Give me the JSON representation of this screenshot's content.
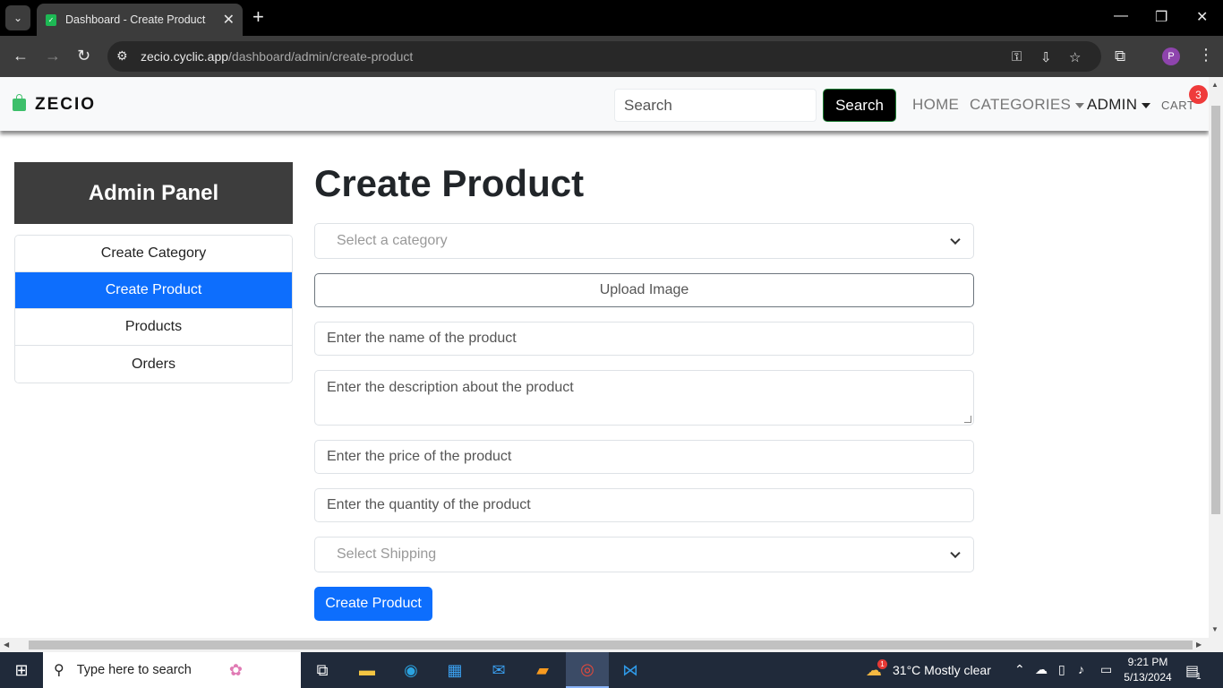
{
  "browser": {
    "tab_title": "Dashboard - Create Product",
    "url_domain": "zecio.cyclic.app",
    "url_path": "/dashboard/admin/create-product",
    "profile_initial": "P"
  },
  "navbar": {
    "brand": "ZECIO",
    "search_placeholder": "Search",
    "search_button": "Search",
    "links": {
      "home": "HOME",
      "categories": "CATEGORIES",
      "admin": "ADMIN",
      "cart": "CART"
    },
    "cart_count": "3"
  },
  "sidebar": {
    "title": "Admin Panel",
    "items": [
      {
        "label": "Create Category",
        "active": false
      },
      {
        "label": "Create Product",
        "active": true
      },
      {
        "label": "Products",
        "active": false
      },
      {
        "label": "Orders",
        "active": false
      }
    ]
  },
  "form": {
    "heading": "Create Product",
    "category_placeholder": "Select a category",
    "upload_label": "Upload Image",
    "name_placeholder": "Enter the name of the product",
    "description_placeholder": "Enter the description about the product",
    "price_placeholder": "Enter the price of the product",
    "quantity_placeholder": "Enter the quantity of the product",
    "shipping_placeholder": "Select Shipping",
    "submit_label": "Create Product"
  },
  "taskbar": {
    "search_placeholder": "Type here to search",
    "weather": "31°C  Mostly clear",
    "weather_badge": "1",
    "time": "9:21 PM",
    "date": "5/13/2024",
    "notification_count": "1"
  },
  "colors": {
    "primary": "#0d6efd",
    "admin_header": "#3d3d3d",
    "cart_badge": "#ef3b3b",
    "brand_icon": "#3dbf6a"
  }
}
